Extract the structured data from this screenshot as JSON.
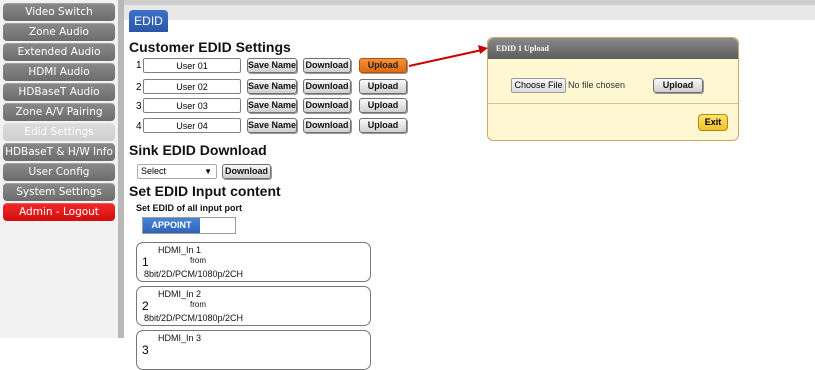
{
  "sidebar": {
    "items": [
      {
        "label": "Video Switch"
      },
      {
        "label": "Zone Audio"
      },
      {
        "label": "Extended Audio"
      },
      {
        "label": "HDMI Audio"
      },
      {
        "label": "HDBaseT Audio"
      },
      {
        "label": "Zone A/V Pairing"
      },
      {
        "label": "Edid Settings"
      },
      {
        "label": "HDBaseT & H/W Info"
      },
      {
        "label": "User Config"
      },
      {
        "label": "System Settings"
      },
      {
        "label": "Admin - Logout"
      }
    ]
  },
  "tab": {
    "label": "EDID"
  },
  "customer_edid": {
    "title": "Customer EDID Settings",
    "rows": [
      {
        "num": "1",
        "name": "User 01",
        "save": "Save Name",
        "download": "Download",
        "upload": "Upload"
      },
      {
        "num": "2",
        "name": "User 02",
        "save": "Save Name",
        "download": "Download",
        "upload": "Upload"
      },
      {
        "num": "3",
        "name": "User 03",
        "save": "Save Name",
        "download": "Download",
        "upload": "Upload"
      },
      {
        "num": "4",
        "name": "User 04",
        "save": "Save Name",
        "download": "Download",
        "upload": "Upload"
      }
    ]
  },
  "sink_edid": {
    "title": "Sink EDID Download",
    "select_value": "Select",
    "download": "Download"
  },
  "set_edid": {
    "title": "Set EDID Input content",
    "subtitle": "Set EDID of all input port",
    "toggle_label": "APPOINT",
    "ports": [
      {
        "num": "1",
        "name": "HDMI_In 1",
        "from": "from",
        "spec": "8bit/2D/PCM/1080p/2CH"
      },
      {
        "num": "2",
        "name": "HDMI_In 2",
        "from": "from",
        "spec": "8bit/2D/PCM/1080p/2CH"
      },
      {
        "num": "3",
        "name": "HDMI_In 3",
        "from": "",
        "spec": ""
      }
    ]
  },
  "dialog": {
    "title": "EDID 1 Upload",
    "choose_file": "Choose File",
    "no_file": "No file chosen",
    "upload": "Upload",
    "exit": "Exit"
  },
  "colors": {
    "accent_blue": "#2f65b8",
    "highlight_orange": "#e06a0e",
    "logout_red": "#e01a1a",
    "arrow_red": "#cc0000"
  }
}
